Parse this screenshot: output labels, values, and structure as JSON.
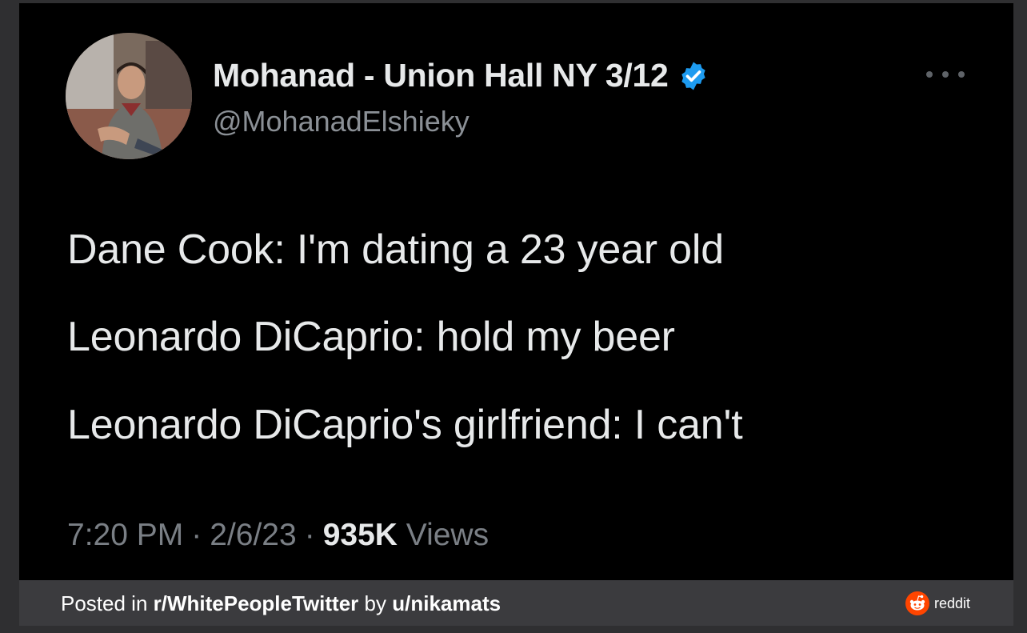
{
  "tweet": {
    "display_name": "Mohanad - Union Hall NY 3/12",
    "handle": "@MohanadElshieky",
    "lines": [
      "Dane Cook: I'm dating a 23 year old",
      "Leonardo DiCaprio: hold my beer",
      "Leonardo DiCaprio's girlfriend: I can't"
    ],
    "time": "7:20 PM",
    "date": "2/6/23",
    "views_count": "935K",
    "views_label": "Views",
    "separator": "·"
  },
  "footer": {
    "posted_in": "Posted in",
    "subreddit": "r/WhitePeopleTwitter",
    "by": "by",
    "user": "u/nikamats",
    "brand": "reddit"
  },
  "icons": {
    "verified": "verified-badge-icon",
    "more": "more-horizontal-icon",
    "reddit": "reddit-alien-icon"
  },
  "colors": {
    "background": "#000000",
    "text_primary": "#e7e9ea",
    "text_secondary": "#7a7f85",
    "verified": "#1d9bf0",
    "reddit": "#ff4500",
    "footer_bg": "#3b3b3e"
  }
}
